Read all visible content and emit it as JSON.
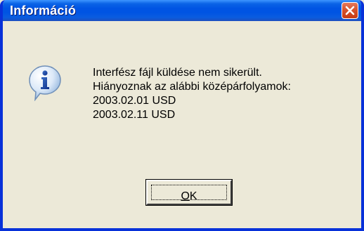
{
  "window": {
    "title": "Információ"
  },
  "icons": {
    "close": "close-icon",
    "info": "information-icon"
  },
  "message": {
    "lines": [
      "Interfész fájl küldése nem sikerült.",
      "Hiányoznak az alábbi középárfolyamok:",
      "2003.02.01 USD",
      "2003.02.11 USD"
    ]
  },
  "buttons": {
    "ok_mnemonic": "O",
    "ok_rest": "K"
  },
  "colors": {
    "titlebar": "#0054e3",
    "dialog_background": "#ece9d8",
    "close_button": "#d5532d"
  }
}
